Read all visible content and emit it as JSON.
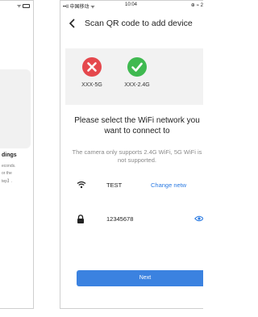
{
  "left_phone": {
    "status_icons": "ᯤ",
    "section_heading": "dings",
    "text_lines": [
      "econds.",
      "or the",
      "tep】."
    ]
  },
  "status_bar": {
    "carrier": "••ll 中国移动 ᯤ",
    "time": "10:04",
    "right": "⊕ ⌁ 2"
  },
  "header": {
    "back_icon": "chevron-left-icon",
    "title": "Scan QR code to add device"
  },
  "networks": [
    {
      "label": "XXX-5G",
      "status": "unsupported",
      "color": "#e5484d",
      "icon": "x-circle-icon"
    },
    {
      "label": "XXX-2.4G",
      "status": "supported",
      "color": "#3fb950",
      "icon": "check-circle-icon"
    }
  ],
  "select_title": "Please select the WiFi network you want to connect to",
  "notice": "The camera only supports 2.4G WiFi, 5G WiFi is not supported.",
  "wifi_row": {
    "icon": "wifi-icon",
    "ssid": "TEST",
    "change_link": "Change netw"
  },
  "password_row": {
    "icon": "lock-icon",
    "password": "12345678",
    "toggle_icon": "eye-icon"
  },
  "next_button": {
    "label": "Next"
  },
  "colors": {
    "accent": "#3b82e0",
    "link": "#2a7ae2",
    "error": "#e5484d",
    "success": "#3fb950"
  }
}
